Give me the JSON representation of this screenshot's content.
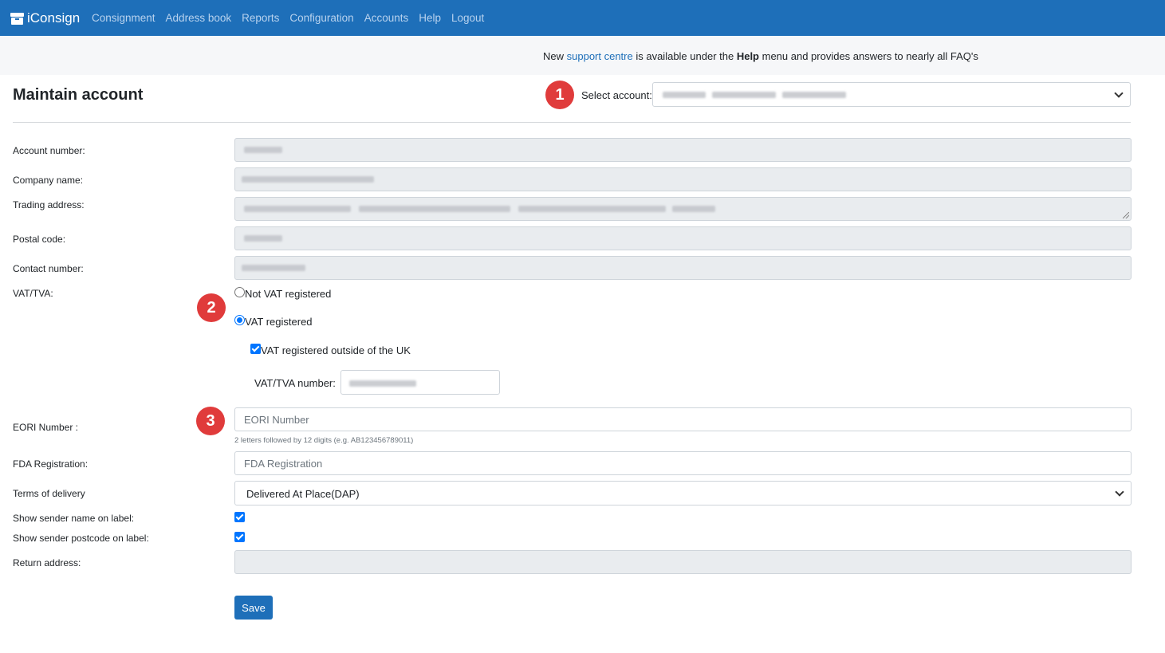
{
  "app": {
    "brand": "iConsign",
    "brand_icon": "package-icon",
    "nav": [
      "Consignment",
      "Address book",
      "Reports",
      "Configuration",
      "Accounts",
      "Help",
      "Logout"
    ]
  },
  "notice": {
    "prefix": "New ",
    "link": "support centre",
    "middle": " is available under the ",
    "bold": "Help",
    "suffix": " menu and provides answers to nearly all FAQ's"
  },
  "page": {
    "title": "Maintain account",
    "select_account_label": "Select account:"
  },
  "markers": [
    "1",
    "2",
    "3"
  ],
  "form": {
    "account_number_label": "Account number:",
    "company_name_label": "Company name:",
    "trading_address_label": "Trading address:",
    "postal_code_label": "Postal code:",
    "contact_number_label": "Contact number:",
    "vat_label": "VAT/TVA:",
    "vat_options": {
      "not_registered": "Not VAT registered",
      "registered": "VAT registered",
      "selected": "registered"
    },
    "vat_outside_uk": {
      "label": "VAT registered outside of the UK",
      "checked": true
    },
    "vat_number_label": "VAT/TVA number:",
    "eori_label": "EORI Number :",
    "eori_placeholder": "EORI Number",
    "eori_help": "2 letters followed by 12 digits (e.g. AB123456789011)",
    "fda_label": "FDA Registration:",
    "fda_placeholder": "FDA Registration",
    "terms_label": "Terms of delivery",
    "terms_value": "Delivered At Place(DAP)",
    "show_sender_name": {
      "label": "Show sender name on label:",
      "checked": true
    },
    "show_sender_postcode": {
      "label": "Show sender postcode on label:",
      "checked": true
    },
    "return_address_label": "Return address:",
    "save_label": "Save"
  },
  "colors": {
    "navbar": "#1e6fb9",
    "marker": "#e03b3b",
    "accent": "#0075ff",
    "readonly_field": "#e9ecef"
  }
}
